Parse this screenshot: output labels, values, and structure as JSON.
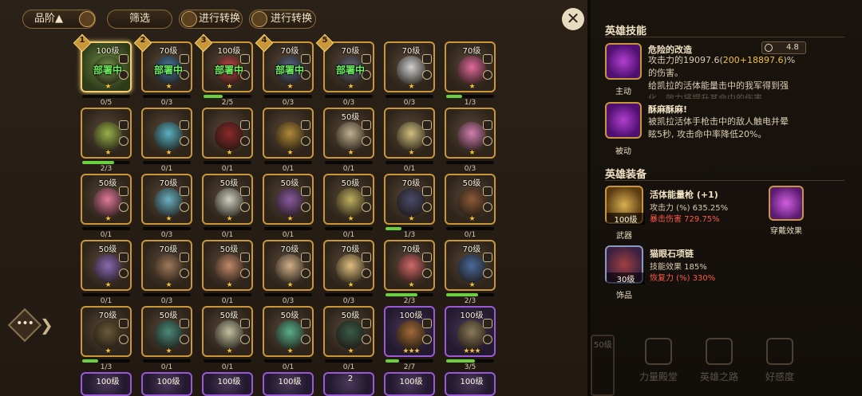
{
  "topbar": {
    "sort_label": "品阶▲",
    "filter_label": "筛选",
    "convert1_label": "进行转换",
    "convert2_label": "进行转换"
  },
  "close_glyph": "✕",
  "side_dots": "•••",
  "side_chevron": "❯",
  "heroes": [
    {
      "lvl": "100级",
      "frag": "0/5",
      "progress": 0,
      "stars": "★",
      "deployed": "部署中",
      "slot": "1",
      "face": "#7a9a4a",
      "frame": "selected"
    },
    {
      "lvl": "70级",
      "frag": "0/3",
      "progress": 0,
      "stars": "★",
      "deployed": "部署中",
      "slot": "2",
      "face": "#4a7aa0",
      "frame": "gold"
    },
    {
      "lvl": "100级",
      "frag": "2/5",
      "progress": 0.4,
      "stars": "★",
      "deployed": "部署中",
      "slot": "3",
      "face": "#c04a4a",
      "frame": "gold"
    },
    {
      "lvl": "70级",
      "frag": "0/3",
      "progress": 0,
      "stars": "★",
      "deployed": "部署中",
      "slot": "4",
      "face": "#5a6a8a",
      "frame": "gold"
    },
    {
      "lvl": "70级",
      "frag": "0/3",
      "progress": 0,
      "stars": "★",
      "deployed": "部署中",
      "slot": "5",
      "face": "#6a6a7a",
      "frame": "gold"
    },
    {
      "lvl": "70级",
      "frag": "0/3",
      "progress": 0,
      "stars": "★",
      "deployed": "",
      "slot": "",
      "face": "#d0d0d0",
      "frame": "gold"
    },
    {
      "lvl": "70级",
      "frag": "1/3",
      "progress": 0.33,
      "stars": "★",
      "deployed": "",
      "slot": "",
      "face": "#e06a9a",
      "frame": "gold"
    },
    {
      "lvl": "",
      "frag": "2/3",
      "progress": 0.67,
      "stars": "★",
      "deployed": "",
      "slot": "",
      "face": "#9ab04a",
      "frame": "gold"
    },
    {
      "lvl": "",
      "frag": "0/1",
      "progress": 0,
      "stars": "★",
      "deployed": "",
      "slot": "",
      "face": "#5ab0c0",
      "frame": "gold"
    },
    {
      "lvl": "",
      "frag": "0/1",
      "progress": 0,
      "stars": "★",
      "deployed": "",
      "slot": "",
      "face": "#8a2a2a",
      "frame": "gold"
    },
    {
      "lvl": "",
      "frag": "0/1",
      "progress": 0,
      "stars": "★",
      "deployed": "",
      "slot": "",
      "face": "#b08a3a",
      "frame": "gold"
    },
    {
      "lvl": "50级",
      "frag": "0/1",
      "progress": 0,
      "stars": "★",
      "deployed": "",
      "slot": "",
      "face": "#c0b090",
      "frame": "gold"
    },
    {
      "lvl": "",
      "frag": "0/1",
      "progress": 0,
      "stars": "★",
      "deployed": "",
      "slot": "",
      "face": "#d0c080",
      "frame": "gold"
    },
    {
      "lvl": "",
      "frag": "0/3",
      "progress": 0,
      "stars": "★",
      "deployed": "",
      "slot": "",
      "face": "#d080b0",
      "frame": "gold"
    },
    {
      "lvl": "50级",
      "frag": "0/1",
      "progress": 0,
      "stars": "★",
      "deployed": "",
      "slot": "",
      "face": "#e07a9a",
      "frame": "gold"
    },
    {
      "lvl": "70级",
      "frag": "0/3",
      "progress": 0,
      "stars": "★",
      "deployed": "",
      "slot": "",
      "face": "#6ab0c0",
      "frame": "gold"
    },
    {
      "lvl": "50级",
      "frag": "0/1",
      "progress": 0,
      "stars": "★",
      "deployed": "",
      "slot": "",
      "face": "#d0d0c0",
      "frame": "gold"
    },
    {
      "lvl": "50级",
      "frag": "0/1",
      "progress": 0,
      "stars": "★",
      "deployed": "",
      "slot": "",
      "face": "#8a5aa0",
      "frame": "gold"
    },
    {
      "lvl": "50级",
      "frag": "0/1",
      "progress": 0,
      "stars": "★",
      "deployed": "",
      "slot": "",
      "face": "#c0b060",
      "frame": "gold"
    },
    {
      "lvl": "70级",
      "frag": "1/3",
      "progress": 0.33,
      "stars": "★",
      "deployed": "",
      "slot": "",
      "face": "#4a4a6a",
      "frame": "gold"
    },
    {
      "lvl": "50级",
      "frag": "0/1",
      "progress": 0,
      "stars": "★",
      "deployed": "",
      "slot": "",
      "face": "#8a5a3a",
      "frame": "gold"
    },
    {
      "lvl": "50级",
      "frag": "0/1",
      "progress": 0,
      "stars": "★",
      "deployed": "",
      "slot": "",
      "face": "#8a6ab0",
      "frame": "gold"
    },
    {
      "lvl": "70级",
      "frag": "0/3",
      "progress": 0,
      "stars": "★",
      "deployed": "",
      "slot": "",
      "face": "#a07a5a",
      "frame": "gold"
    },
    {
      "lvl": "50级",
      "frag": "0/1",
      "progress": 0,
      "stars": "★",
      "deployed": "",
      "slot": "",
      "face": "#c08a6a",
      "frame": "gold"
    },
    {
      "lvl": "70级",
      "frag": "0/3",
      "progress": 0,
      "stars": "★",
      "deployed": "",
      "slot": "",
      "face": "#d0b08a",
      "frame": "gold"
    },
    {
      "lvl": "70级",
      "frag": "0/3",
      "progress": 0,
      "stars": "★",
      "deployed": "",
      "slot": "",
      "face": "#e0c080",
      "frame": "gold"
    },
    {
      "lvl": "70级",
      "frag": "2/3",
      "progress": 0.67,
      "stars": "★",
      "deployed": "",
      "slot": "",
      "face": "#d06a6a",
      "frame": "gold"
    },
    {
      "lvl": "70级",
      "frag": "2/3",
      "progress": 0.67,
      "stars": "★",
      "deployed": "",
      "slot": "",
      "face": "#4a6a9a",
      "frame": "gold"
    },
    {
      "lvl": "70级",
      "frag": "1/3",
      "progress": 0.33,
      "stars": "★",
      "deployed": "",
      "slot": "",
      "face": "#6a5a3a",
      "frame": "gold"
    },
    {
      "lvl": "50级",
      "frag": "0/1",
      "progress": 0,
      "stars": "★",
      "deployed": "",
      "slot": "",
      "face": "#4a8a7a",
      "frame": "gold"
    },
    {
      "lvl": "50级",
      "frag": "0/1",
      "progress": 0,
      "stars": "★",
      "deployed": "",
      "slot": "",
      "face": "#c0c0a0",
      "frame": "gold"
    },
    {
      "lvl": "50级",
      "frag": "0/1",
      "progress": 0,
      "stars": "★",
      "deployed": "",
      "slot": "",
      "face": "#5ab08a",
      "frame": "gold"
    },
    {
      "lvl": "50级",
      "frag": "0/1",
      "progress": 0,
      "stars": "★",
      "deployed": "",
      "slot": "",
      "face": "#3a5a4a",
      "frame": "gold"
    },
    {
      "lvl": "100级",
      "frag": "2/7",
      "progress": 0.29,
      "stars": "★★★",
      "deployed": "",
      "slot": "",
      "face": "#a06a3a",
      "frame": "purple"
    },
    {
      "lvl": "100级",
      "frag": "3/5",
      "progress": 0.6,
      "stars": "★★★",
      "deployed": "",
      "slot": "",
      "face": "#8a7a5a",
      "frame": "purple"
    }
  ],
  "bottom_row": [
    "100级",
    "100级",
    "100级",
    "100级",
    "2",
    "100级",
    "100级"
  ],
  "detail": {
    "skills_title": "英雄技能",
    "active": {
      "name": "危险的改造",
      "cooldown": "4.8",
      "tag": "主动",
      "line1_a": "攻击力的19097.6(",
      "line1_b": "200+18897.6",
      "line1_c": ")%",
      "line2": "的伤害。",
      "line3": "给凯拉的活体能量击中的我军得到强",
      "line4": "化。效力将提升其命中的伤害。"
    },
    "passive": {
      "name": "酥麻酥麻!",
      "tag": "被动",
      "line1": "被凯拉活体手枪击中的敌人触电并晕",
      "line2": "眩5秒, 攻击命中率降低20%。"
    },
    "equip_title": "英雄装备",
    "weapon": {
      "name": "活体能量枪 (+1)",
      "lvl": "100级",
      "tag": "武器",
      "stat1": "攻击力 (%) 635.25%",
      "stat2": "暴击伤害 729.75%"
    },
    "effect_label": "穿戴效果",
    "accessory": {
      "name": "猫眼石项链",
      "lvl": "30级",
      "tag": "饰品",
      "stat1": "技能效果 185%",
      "stat2": "恢复力 (%) 330%"
    },
    "nav": [
      "力量殿堂",
      "英雄之路",
      "好感度"
    ],
    "dim_card": "50级"
  },
  "colors": {
    "gold_frame": "#c9963a",
    "purple_frame": "#9a5ad8",
    "deployed_text": "#6ef060",
    "highlight": "#f5c030",
    "red_stat": "#ff5a4a"
  }
}
